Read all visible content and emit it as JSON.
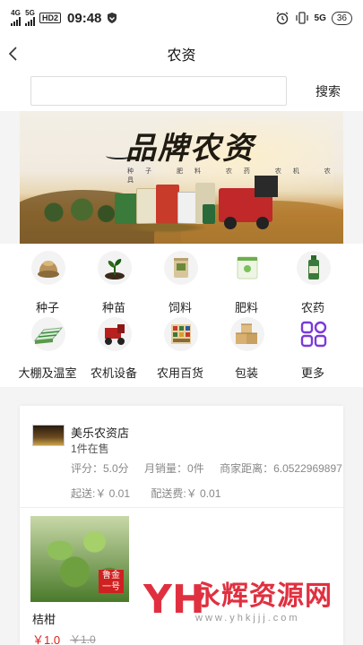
{
  "status_bar": {
    "network1": "4G",
    "network2": "5G",
    "hd": "HD2",
    "time": "09:48",
    "battery": "36",
    "right_network": "5G"
  },
  "header": {
    "title": "农资",
    "back_icon": "chevron-left-icon"
  },
  "search": {
    "value": "",
    "placeholder": "",
    "button_label": "搜索"
  },
  "banner": {
    "title": "品牌农资",
    "subtitle": "种子 肥料 农药 农机 农具"
  },
  "categories": [
    {
      "label": "种子",
      "icon": "seed-bag-icon"
    },
    {
      "label": "种苗",
      "icon": "seedling-icon"
    },
    {
      "label": "饲料",
      "icon": "feed-bag-icon"
    },
    {
      "label": "肥料",
      "icon": "fertilizer-bag-icon"
    },
    {
      "label": "农药",
      "icon": "pesticide-bottle-icon"
    },
    {
      "label": "大棚及温室",
      "icon": "greenhouse-icon"
    },
    {
      "label": "农机设备",
      "icon": "tractor-icon"
    },
    {
      "label": "农用百货",
      "icon": "general-goods-icon"
    },
    {
      "label": "包装",
      "icon": "boxes-icon"
    },
    {
      "label": "更多",
      "icon": "more-grid-icon"
    }
  ],
  "shop": {
    "name": "美乐农资店",
    "on_sale": "1件在售",
    "rating": "评分：5.0分",
    "monthly_sales": "月销量：0件",
    "distance": "商家距离：6.0522969897",
    "min_order": "起送:￥ 0.01",
    "delivery_fee": "配送费:￥ 0.01",
    "product": {
      "name": "桔柑",
      "price": "￥1.0",
      "old_price": "￥1.0",
      "tag": "鲁金一号"
    }
  },
  "watermark": {
    "mark": "YH",
    "text": "永辉资源网",
    "url": "www.yhkjjj.com"
  },
  "colors": {
    "accent_red": "#e02020",
    "watermark_red": "#e03040"
  }
}
